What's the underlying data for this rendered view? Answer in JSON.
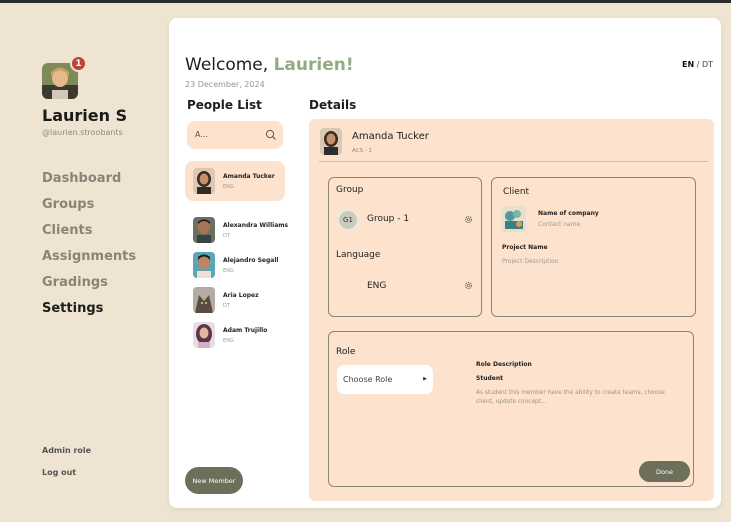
{
  "sidebar": {
    "user_name": "Laurien S",
    "user_handle": "@laurien.stroobants",
    "notification_count": "1",
    "nav": [
      {
        "label": "Dashboard",
        "active": false
      },
      {
        "label": "Groups",
        "active": false
      },
      {
        "label": "Clients",
        "active": false
      },
      {
        "label": "Assignments",
        "active": false
      },
      {
        "label": "Gradings",
        "active": false
      },
      {
        "label": "Settings",
        "active": true
      }
    ],
    "admin_role": "Admin role",
    "logout": "Log out"
  },
  "header": {
    "welcome": "Welcome,",
    "name": "Laurien!",
    "date": "23 December, 2024",
    "lang_active": "EN",
    "lang_sep": "/",
    "lang_other": "DT"
  },
  "people": {
    "title": "People List",
    "search_placeholder": "A...",
    "list": [
      {
        "name": "Amanda Tucker",
        "lang": "ENG"
      },
      {
        "name": "Alexandra Williams",
        "lang": "DT"
      },
      {
        "name": "Alejandro Segall",
        "lang": "ENG"
      },
      {
        "name": "Aria Lopez",
        "lang": "DT"
      },
      {
        "name": "Adam Trujillo",
        "lang": "ENG"
      }
    ],
    "new_member": "New Member"
  },
  "details": {
    "title": "Details",
    "person_name": "Amanda Tucker",
    "person_code": "ACS - 1",
    "group_label": "Group",
    "group_badge": "G1",
    "group_value": "Group - 1",
    "language_label": "Language",
    "language_value": "ENG",
    "client_label": "Client",
    "company_name": "Name of company",
    "contact_name": "Contact name",
    "project_name_label": "Project Name",
    "project_description": "Project Description",
    "role_label": "Role",
    "choose_role": "Choose Role",
    "role_desc_label": "Role Description",
    "role_name": "Student",
    "role_desc_text": "As student this member have the ability to create teams, choose client, update concept...",
    "done": "Done"
  },
  "colors": {
    "background": "#efe4d2",
    "accent_green": "#94ab82",
    "panel_peach": "#fde3cd",
    "button_olive": "#6d6f5b",
    "badge_red": "#c0403a"
  }
}
